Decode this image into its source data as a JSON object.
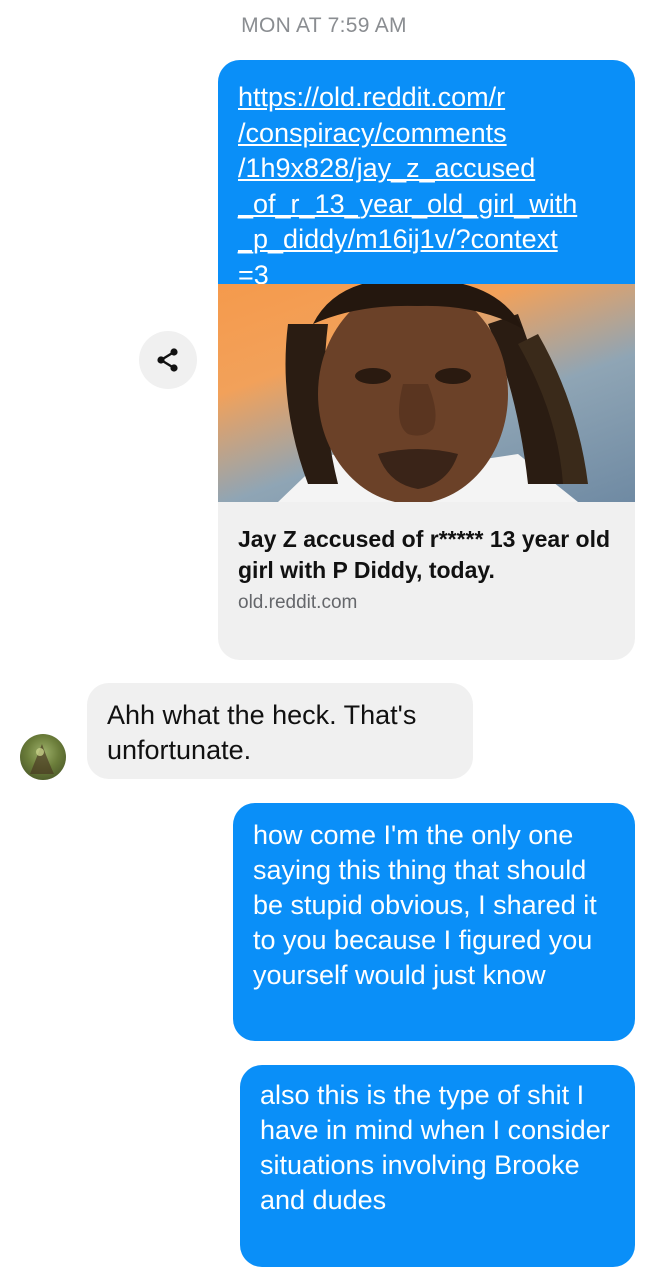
{
  "conversation": {
    "timestamp": "MON AT 7:59 AM",
    "link_message": {
      "url_text": "https://old.reddit.com/r\n/conspiracy/comments\n/1h9x828/jay_z_accused\n_of_r_13_year_old_girl_with\n_p_diddy/m16ij1v/?context\n=3",
      "preview_title": "Jay Z accused of r***** 13 year old girl with P Diddy, today.",
      "preview_domain": "old.reddit.com"
    },
    "share_icon": "share-icon",
    "incoming_message": "Ahh what the heck. That's\nunfortunate.",
    "outgoing_messages": [
      "how come I'm the only one saying this thing that should be stupid obvious, I shared it to you because I figured you yourself would just know",
      "also this is the type of shit I have in mind when I consider situations involving Brooke and dudes"
    ]
  },
  "colors": {
    "outgoing_bubble": "#0a8ff8",
    "incoming_bubble": "#f0f0f0",
    "timestamp_text": "#8a8d91"
  }
}
